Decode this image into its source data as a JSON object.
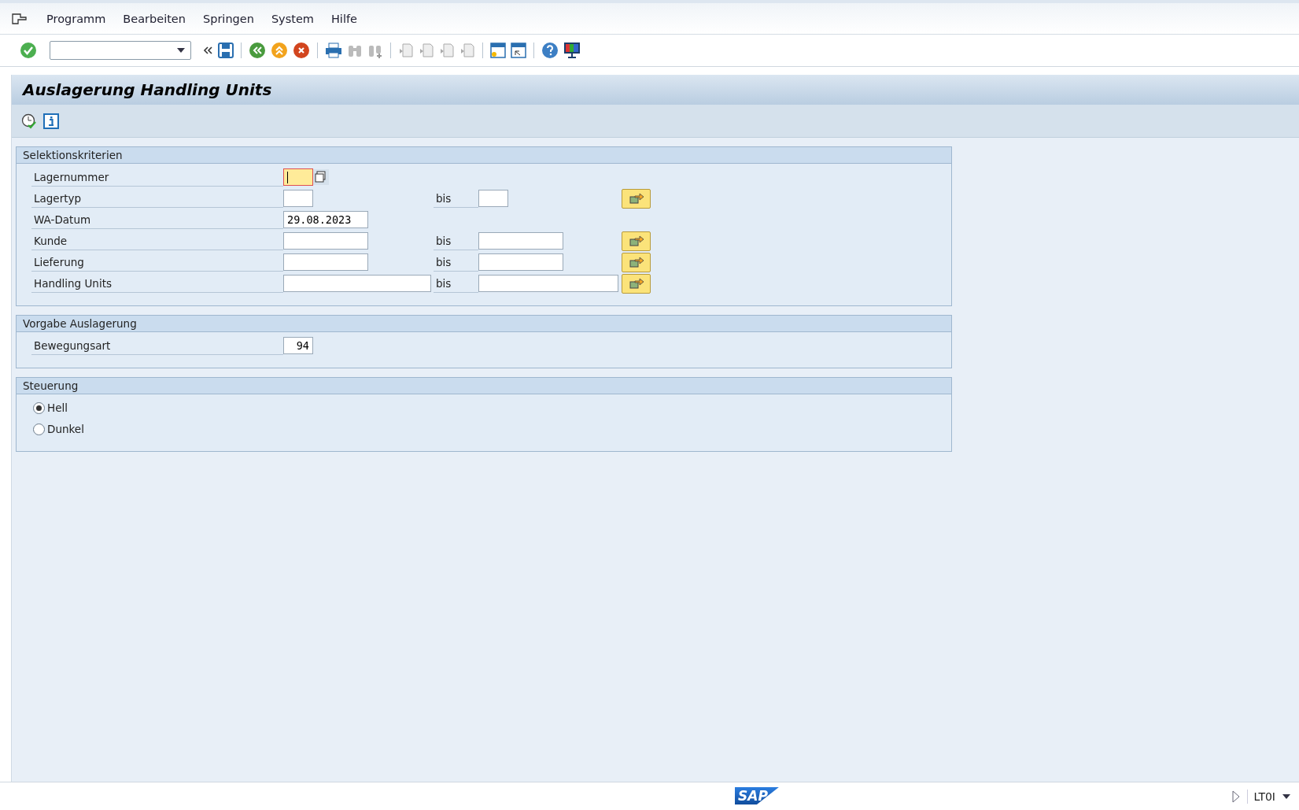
{
  "menu": [
    "Programm",
    "Bearbeiten",
    "Springen",
    "System",
    "Hilfe"
  ],
  "title": "Auslagerung Handling Units",
  "groups": [
    {
      "title": "Selektionskriterien",
      "rows": [
        {
          "kind": "field",
          "label": "Lagernummer",
          "focused": true
        },
        {
          "kind": "range",
          "label": "Lagertyp",
          "to_label": "bis"
        },
        {
          "kind": "field",
          "label": "WA-Datum",
          "value": "29.08.2023",
          "focused": false
        },
        {
          "kind": "range",
          "label": "Kunde",
          "to_label": "bis"
        },
        {
          "kind": "range",
          "label": "Lieferung",
          "to_label": "bis"
        },
        {
          "kind": "range",
          "label": "Handling Units",
          "to_label": "bis"
        }
      ]
    },
    {
      "title": "Vorgabe Auslagerung",
      "rows": [
        {
          "kind": "field",
          "label": "Bewegungsart",
          "value": "94",
          "focused": false
        }
      ]
    },
    {
      "title": "Steuerung",
      "rows": [
        {
          "kind": "radio",
          "label": "Hell",
          "selected": true
        },
        {
          "kind": "radio",
          "label": "Dunkel",
          "selected": false
        }
      ]
    }
  ],
  "status_bar": {
    "logo": "SAP",
    "transaction": "LT0I"
  }
}
